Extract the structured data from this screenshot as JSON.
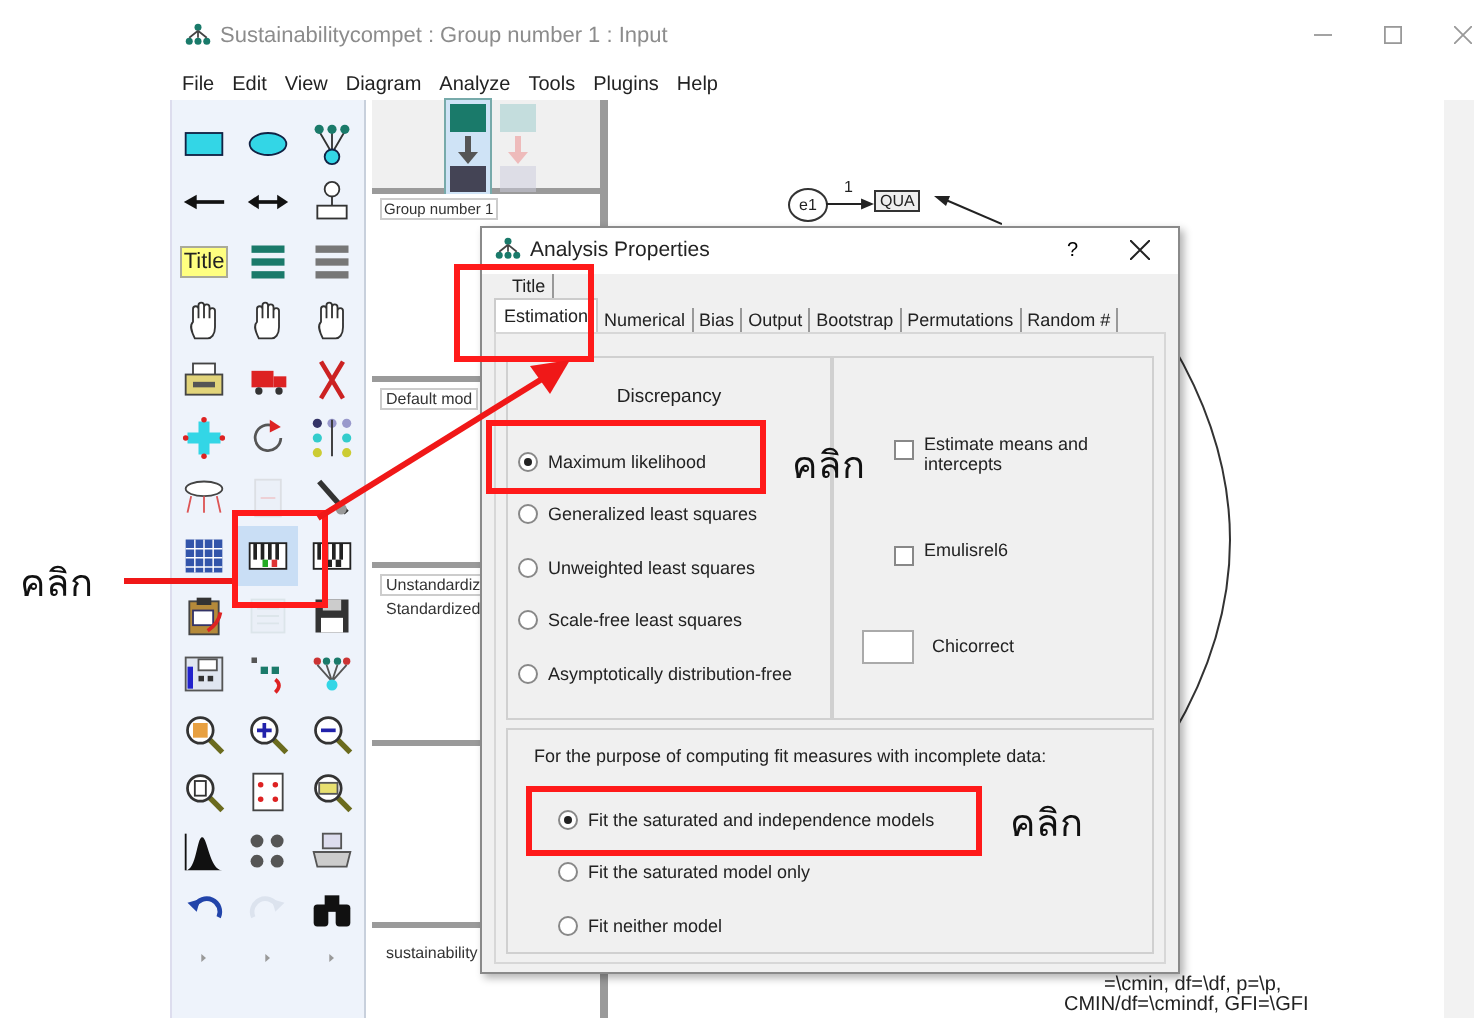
{
  "window": {
    "title": "Sustainabilitycompet : Group number 1 : Input"
  },
  "menu": [
    "File",
    "Edit",
    "View",
    "Diagram",
    "Analyze",
    "Tools",
    "Plugins",
    "Help"
  ],
  "toolbox": [
    {
      "kind": "rectangle",
      "selected": false,
      "disabled": false
    },
    {
      "kind": "ellipse",
      "selected": false,
      "disabled": false
    },
    {
      "kind": "tree",
      "selected": false,
      "disabled": false
    },
    {
      "kind": "arrow",
      "selected": false,
      "disabled": false
    },
    {
      "kind": "doublearrow",
      "selected": false,
      "disabled": false
    },
    {
      "kind": "unique",
      "selected": false,
      "disabled": false
    },
    {
      "kind": "title",
      "label": "Title",
      "selected": false,
      "disabled": false
    },
    {
      "kind": "listmodel",
      "selected": false,
      "disabled": false
    },
    {
      "kind": "listdata",
      "selected": false,
      "disabled": false
    },
    {
      "kind": "hand",
      "selected": false,
      "disabled": false
    },
    {
      "kind": "hand",
      "selected": false,
      "disabled": false
    },
    {
      "kind": "hand",
      "selected": false,
      "disabled": false
    },
    {
      "kind": "copy",
      "selected": false,
      "disabled": false
    },
    {
      "kind": "truck",
      "selected": false,
      "disabled": false
    },
    {
      "kind": "erase",
      "selected": false,
      "disabled": false
    },
    {
      "kind": "cross",
      "selected": false,
      "disabled": false
    },
    {
      "kind": "rotate",
      "selected": false,
      "disabled": false
    },
    {
      "kind": "reflect",
      "selected": false,
      "disabled": false
    },
    {
      "kind": "scroll",
      "selected": false,
      "disabled": false
    },
    {
      "kind": "touchup",
      "selected": false,
      "disabled": true
    },
    {
      "kind": "wand",
      "selected": false,
      "disabled": false
    },
    {
      "kind": "grid",
      "selected": false,
      "disabled": false
    },
    {
      "kind": "keys",
      "selected": true,
      "disabled": false
    },
    {
      "kind": "keysdark",
      "selected": false,
      "disabled": false
    },
    {
      "kind": "clipboard",
      "selected": false,
      "disabled": false
    },
    {
      "kind": "text",
      "selected": false,
      "disabled": true
    },
    {
      "kind": "save",
      "selected": false,
      "disabled": false
    },
    {
      "kind": "props",
      "selected": false,
      "disabled": false
    },
    {
      "kind": "drag",
      "selected": false,
      "disabled": false
    },
    {
      "kind": "symmetry",
      "selected": false,
      "disabled": false
    },
    {
      "kind": "zoomselect",
      "selected": false,
      "disabled": false
    },
    {
      "kind": "zoomin",
      "selected": false,
      "disabled": false
    },
    {
      "kind": "zoomout",
      "selected": false,
      "disabled": false
    },
    {
      "kind": "zoompage",
      "selected": false,
      "disabled": false
    },
    {
      "kind": "fitpage",
      "selected": false,
      "disabled": false
    },
    {
      "kind": "loupe",
      "selected": false,
      "disabled": false
    },
    {
      "kind": "curve",
      "selected": false,
      "disabled": false
    },
    {
      "kind": "groups",
      "selected": false,
      "disabled": false
    },
    {
      "kind": "printer",
      "selected": false,
      "disabled": false
    },
    {
      "kind": "undo",
      "selected": false,
      "disabled": false
    },
    {
      "kind": "redo",
      "selected": false,
      "disabled": true
    },
    {
      "kind": "binoculars",
      "selected": false,
      "disabled": false
    },
    {
      "kind": "more",
      "selected": false,
      "disabled": false
    },
    {
      "kind": "more",
      "selected": false,
      "disabled": false
    },
    {
      "kind": "more",
      "selected": false,
      "disabled": false
    }
  ],
  "model_views": [
    {
      "selected": true
    },
    {
      "selected": false
    }
  ],
  "groups_panel": {
    "items": [
      "Group number 1"
    ]
  },
  "models_panel": {
    "items": [
      "Default mod"
    ]
  },
  "formats_panel": {
    "items": [
      "Unstandardiz",
      "Standardized"
    ]
  },
  "files_panel": {
    "items": [
      "sustainability"
    ]
  },
  "diagram": {
    "error_node": "e1",
    "observed_node": "QUA",
    "path_label": "1",
    "captions": [
      "=\\cmin, df=\\df, p=\\p,",
      "CMIN/df=\\cmindf, GFI=\\GFI"
    ]
  },
  "dialog": {
    "title": "Analysis Properties",
    "help": "?",
    "tabs_top": [
      {
        "label": "Title",
        "selected": false
      }
    ],
    "tabs": [
      {
        "label": "Estimation",
        "selected": true
      },
      {
        "label": "Numerical",
        "selected": false
      },
      {
        "label": "Bias",
        "selected": false
      },
      {
        "label": "Output",
        "selected": false
      },
      {
        "label": "Bootstrap",
        "selected": false
      },
      {
        "label": "Permutations",
        "selected": false
      },
      {
        "label": "Random #",
        "selected": false
      }
    ],
    "discrepancy": {
      "heading": "Discrepancy",
      "options": [
        {
          "label": "Maximum likelihood",
          "selected": true
        },
        {
          "label": "Generalized least squares",
          "selected": false
        },
        {
          "label": "Unweighted least squares",
          "selected": false
        },
        {
          "label": "Scale-free least squares",
          "selected": false
        },
        {
          "label": "Asymptotically distribution-free",
          "selected": false
        }
      ]
    },
    "options": [
      {
        "kind": "checkbox",
        "label": "Estimate means and intercepts",
        "checked": false
      },
      {
        "kind": "checkbox",
        "label": "Emulisrel6",
        "checked": false
      },
      {
        "kind": "textbox",
        "label": "Chicorrect"
      }
    ],
    "incomplete_data": {
      "heading": "For the purpose of computing fit measures with incomplete data:",
      "options": [
        {
          "label": "Fit the saturated and independence models",
          "selected": true
        },
        {
          "label": "Fit the saturated model only",
          "selected": false
        },
        {
          "label": "Fit neither model",
          "selected": false
        }
      ]
    }
  },
  "annotations": [
    "คลิก",
    "คลิก",
    "คลิก"
  ]
}
